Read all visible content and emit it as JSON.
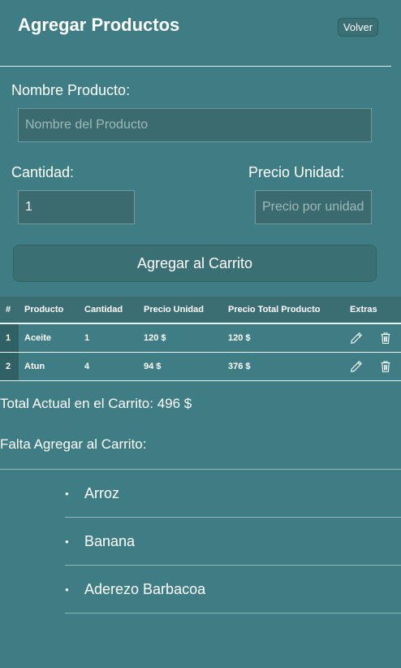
{
  "header": {
    "title": "Agregar Productos",
    "back_label": "Volver"
  },
  "form": {
    "name_label": "Nombre Producto:",
    "name_placeholder": "Nombre del Producto",
    "qty_label": "Cantidad:",
    "qty_value": "1",
    "price_label": "Precio Unidad:",
    "price_placeholder": "Precio por unidad",
    "submit_label": "Agregar al Carrito"
  },
  "table": {
    "headers": [
      "#",
      "Producto",
      "Cantidad",
      "Precio Unidad",
      "Precio Total Producto",
      "Extras"
    ],
    "rows": [
      {
        "idx": "1",
        "product": "Aceite",
        "qty": "1",
        "unit_price": "120 $",
        "total_price": "120 $"
      },
      {
        "idx": "2",
        "product": "Atun",
        "qty": "4",
        "unit_price": "94 $",
        "total_price": "376 $"
      }
    ]
  },
  "summary": {
    "total_text": "Total Actual en el Carrito: 496 $",
    "missing_label": "Falta Agregar al Carrito:"
  },
  "missing_items": [
    "Arroz",
    "Banana",
    "Aderezo Barbacoa"
  ],
  "icons": {
    "edit": "pencil-icon",
    "delete": "trash-icon"
  },
  "colors": {
    "background": "#3e7d83",
    "table_header": "#3a6e72",
    "button": "#3a6f74"
  }
}
